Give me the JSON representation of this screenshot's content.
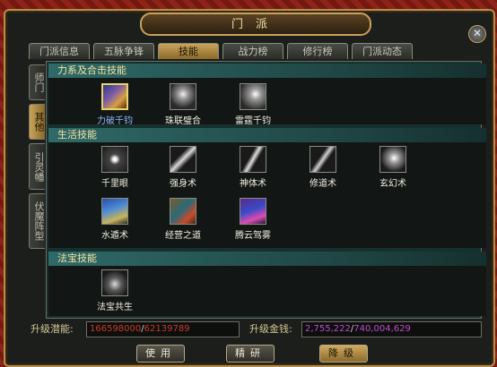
{
  "window": {
    "title": "门派"
  },
  "tabs": [
    "门派信息",
    "五脉争锋",
    "技能",
    "战力榜",
    "修行榜",
    "门派动态"
  ],
  "side_tabs": [
    "师门",
    "其他",
    "引灵幡",
    "伏魔阵型"
  ],
  "sections": [
    {
      "title": "力系及合击技能",
      "skills": [
        "力破千钧",
        "珠联璧合",
        "雷霆千钧"
      ]
    },
    {
      "title": "生活技能",
      "skills": [
        "千里眼",
        "强身术",
        "神体术",
        "修道术",
        "玄幻术",
        "水遁术",
        "经营之道",
        "腾云驾雾"
      ]
    },
    {
      "title": "法宝技能",
      "skills": [
        "法宝共生"
      ]
    }
  ],
  "upgrade": {
    "potential_label": "升级潜能:",
    "potential_current": "166598000",
    "potential_required": "62139789",
    "money_label": "升级金钱:",
    "money_current": "2,755,222",
    "money_required": "740,004,629"
  },
  "buttons": {
    "use": "使用",
    "refine": "精研",
    "downgrade": "降级"
  },
  "colors": {
    "accent": "#c9a35a",
    "red_value": "#c63b2c",
    "purple_value": "#c04ad0"
  }
}
